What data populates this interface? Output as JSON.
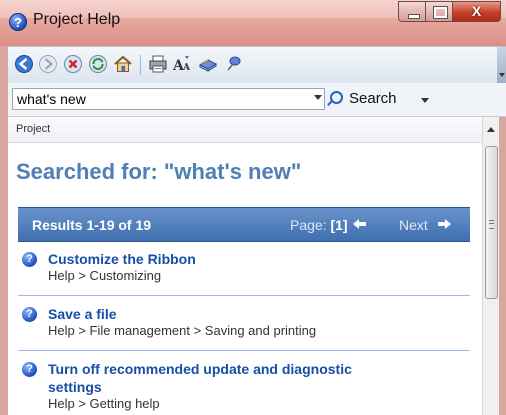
{
  "window": {
    "title": "Project Help"
  },
  "title_controls": {
    "close_label": "X"
  },
  "toolbar": {
    "buttons": [
      "back-icon",
      "forward-icon",
      "stop-icon",
      "refresh-icon",
      "home-icon",
      "print-icon",
      "text-size-icon",
      "table-of-contents-icon",
      "keep-on-top-icon"
    ]
  },
  "search": {
    "query": "what's new",
    "button_label": "Search"
  },
  "breadcrumb": "Project",
  "main": {
    "title": "Searched for: \"what's new\"",
    "results_count": "Results 1-19 of 19",
    "page_label": "Page:",
    "page_number": "[1]",
    "next_label": "Next"
  },
  "results": [
    {
      "title": "Customize the Ribbon",
      "path": "Help > Customizing"
    },
    {
      "title": "Save a file",
      "path": "Help > File management > Saving and printing"
    },
    {
      "title_line1": "Turn off recommended update and diagnostic",
      "title_line2": "settings",
      "path": "Help > Getting help"
    }
  ],
  "icons": {
    "help_glyph": "?"
  }
}
